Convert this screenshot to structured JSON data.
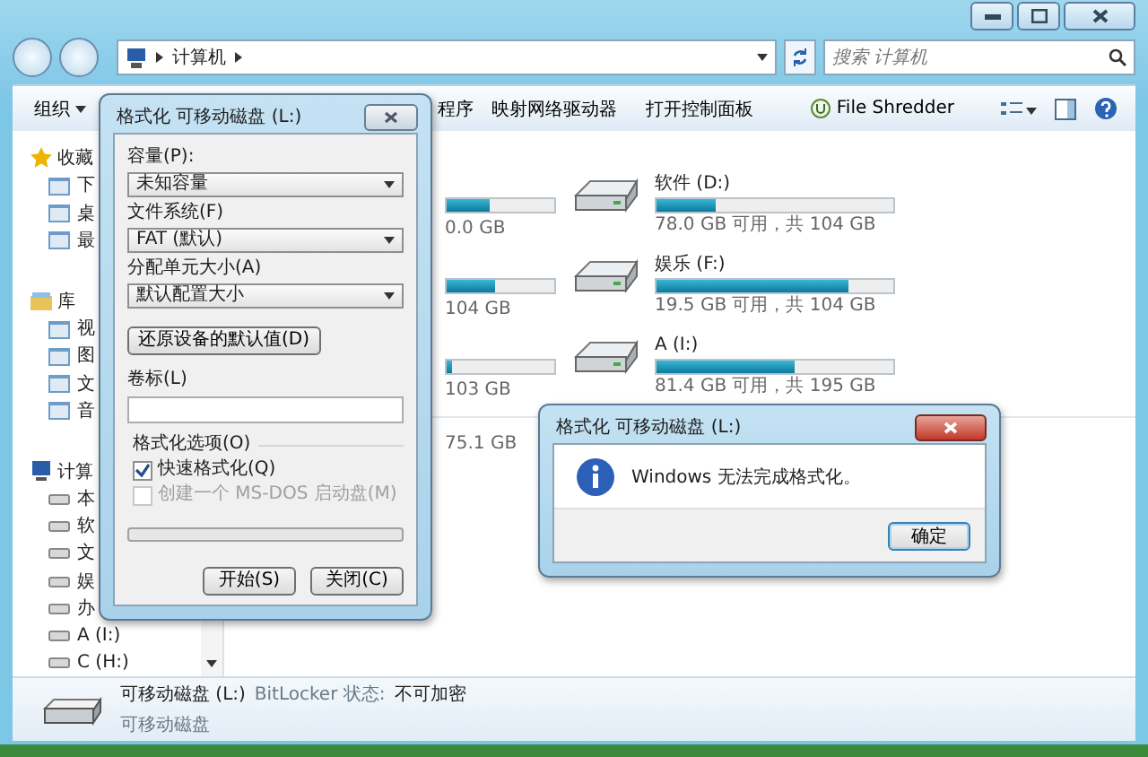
{
  "address_bar": {
    "path": "计算机"
  },
  "search": {
    "placeholder": "搜索 计算机"
  },
  "toolbar": [
    {
      "label": "组织",
      "kind": "menu"
    },
    {
      "label": "程序",
      "kind": "plain"
    },
    {
      "label": "映射网络驱动器",
      "kind": "plain"
    },
    {
      "label": "打开控制面板",
      "kind": "plain"
    },
    {
      "label": "File Shredder",
      "kind": "icon"
    }
  ],
  "sidebar": {
    "items": [
      {
        "label": "收藏",
        "children": [
          {
            "label": "下"
          },
          {
            "label": "桌"
          },
          {
            "label": "最"
          }
        ]
      },
      {
        "label": "库",
        "children": [
          {
            "label": "视"
          },
          {
            "label": "图"
          },
          {
            "label": "文"
          },
          {
            "label": "音"
          }
        ]
      },
      {
        "label": "计算",
        "children": [
          {
            "label": "本"
          },
          {
            "label": "软"
          },
          {
            "label": "文"
          },
          {
            "label": "娱"
          },
          {
            "label": "办"
          },
          {
            "label": "A (I:)"
          },
          {
            "label": "C (H:)"
          }
        ]
      }
    ]
  },
  "drives_partial": [
    {
      "size": "0.0 GB",
      "level": 0.4
    },
    {
      "size": "104 GB",
      "level": 0.45
    },
    {
      "size": "103 GB",
      "level": 0.05
    }
  ],
  "drives": [
    {
      "name": "软件 (D:)",
      "level": 0.25,
      "space": "78.0 GB 可用，共 104 GB"
    },
    {
      "name": "娱乐 (F:)",
      "level": 0.81,
      "space": "19.5 GB 可用，共 104 GB"
    },
    {
      "name": "A (I:)",
      "level": 0.58,
      "space": "81.4 GB 可用，共 195 GB"
    }
  ],
  "removable_partial": {
    "size": "75.1 GB"
  },
  "details": {
    "name": "可移动磁盘 (L:)",
    "label": "BitLocker 状态:",
    "value": "不可加密",
    "type": "可移动磁盘"
  },
  "format_dialog": {
    "title": "格式化 可移动磁盘 (L:)",
    "fields": [
      {
        "label": "容量(P):",
        "value": "未知容量"
      },
      {
        "label": "文件系统(F)",
        "value": "FAT (默认)"
      },
      {
        "label": "分配单元大小(A)",
        "value": "默认配置大小"
      }
    ],
    "restore_button": "还原设备的默认值(D)",
    "volume_label": {
      "label": "卷标(L)"
    },
    "options": {
      "title": "格式化选项(O)",
      "items": [
        {
          "label": "快速格式化(Q)",
          "checked": true,
          "disabled": false
        },
        {
          "label": "创建一个 MS-DOS 启动盘(M)",
          "checked": false,
          "disabled": true
        }
      ]
    },
    "progress": {
      "level": 0
    },
    "buttons": [
      "开始(S)",
      "关闭(C)"
    ]
  },
  "message_box": {
    "title": "格式化 可移动磁盘 (L:)",
    "message": "Windows 无法完成格式化。",
    "buttons": [
      "确定"
    ]
  }
}
